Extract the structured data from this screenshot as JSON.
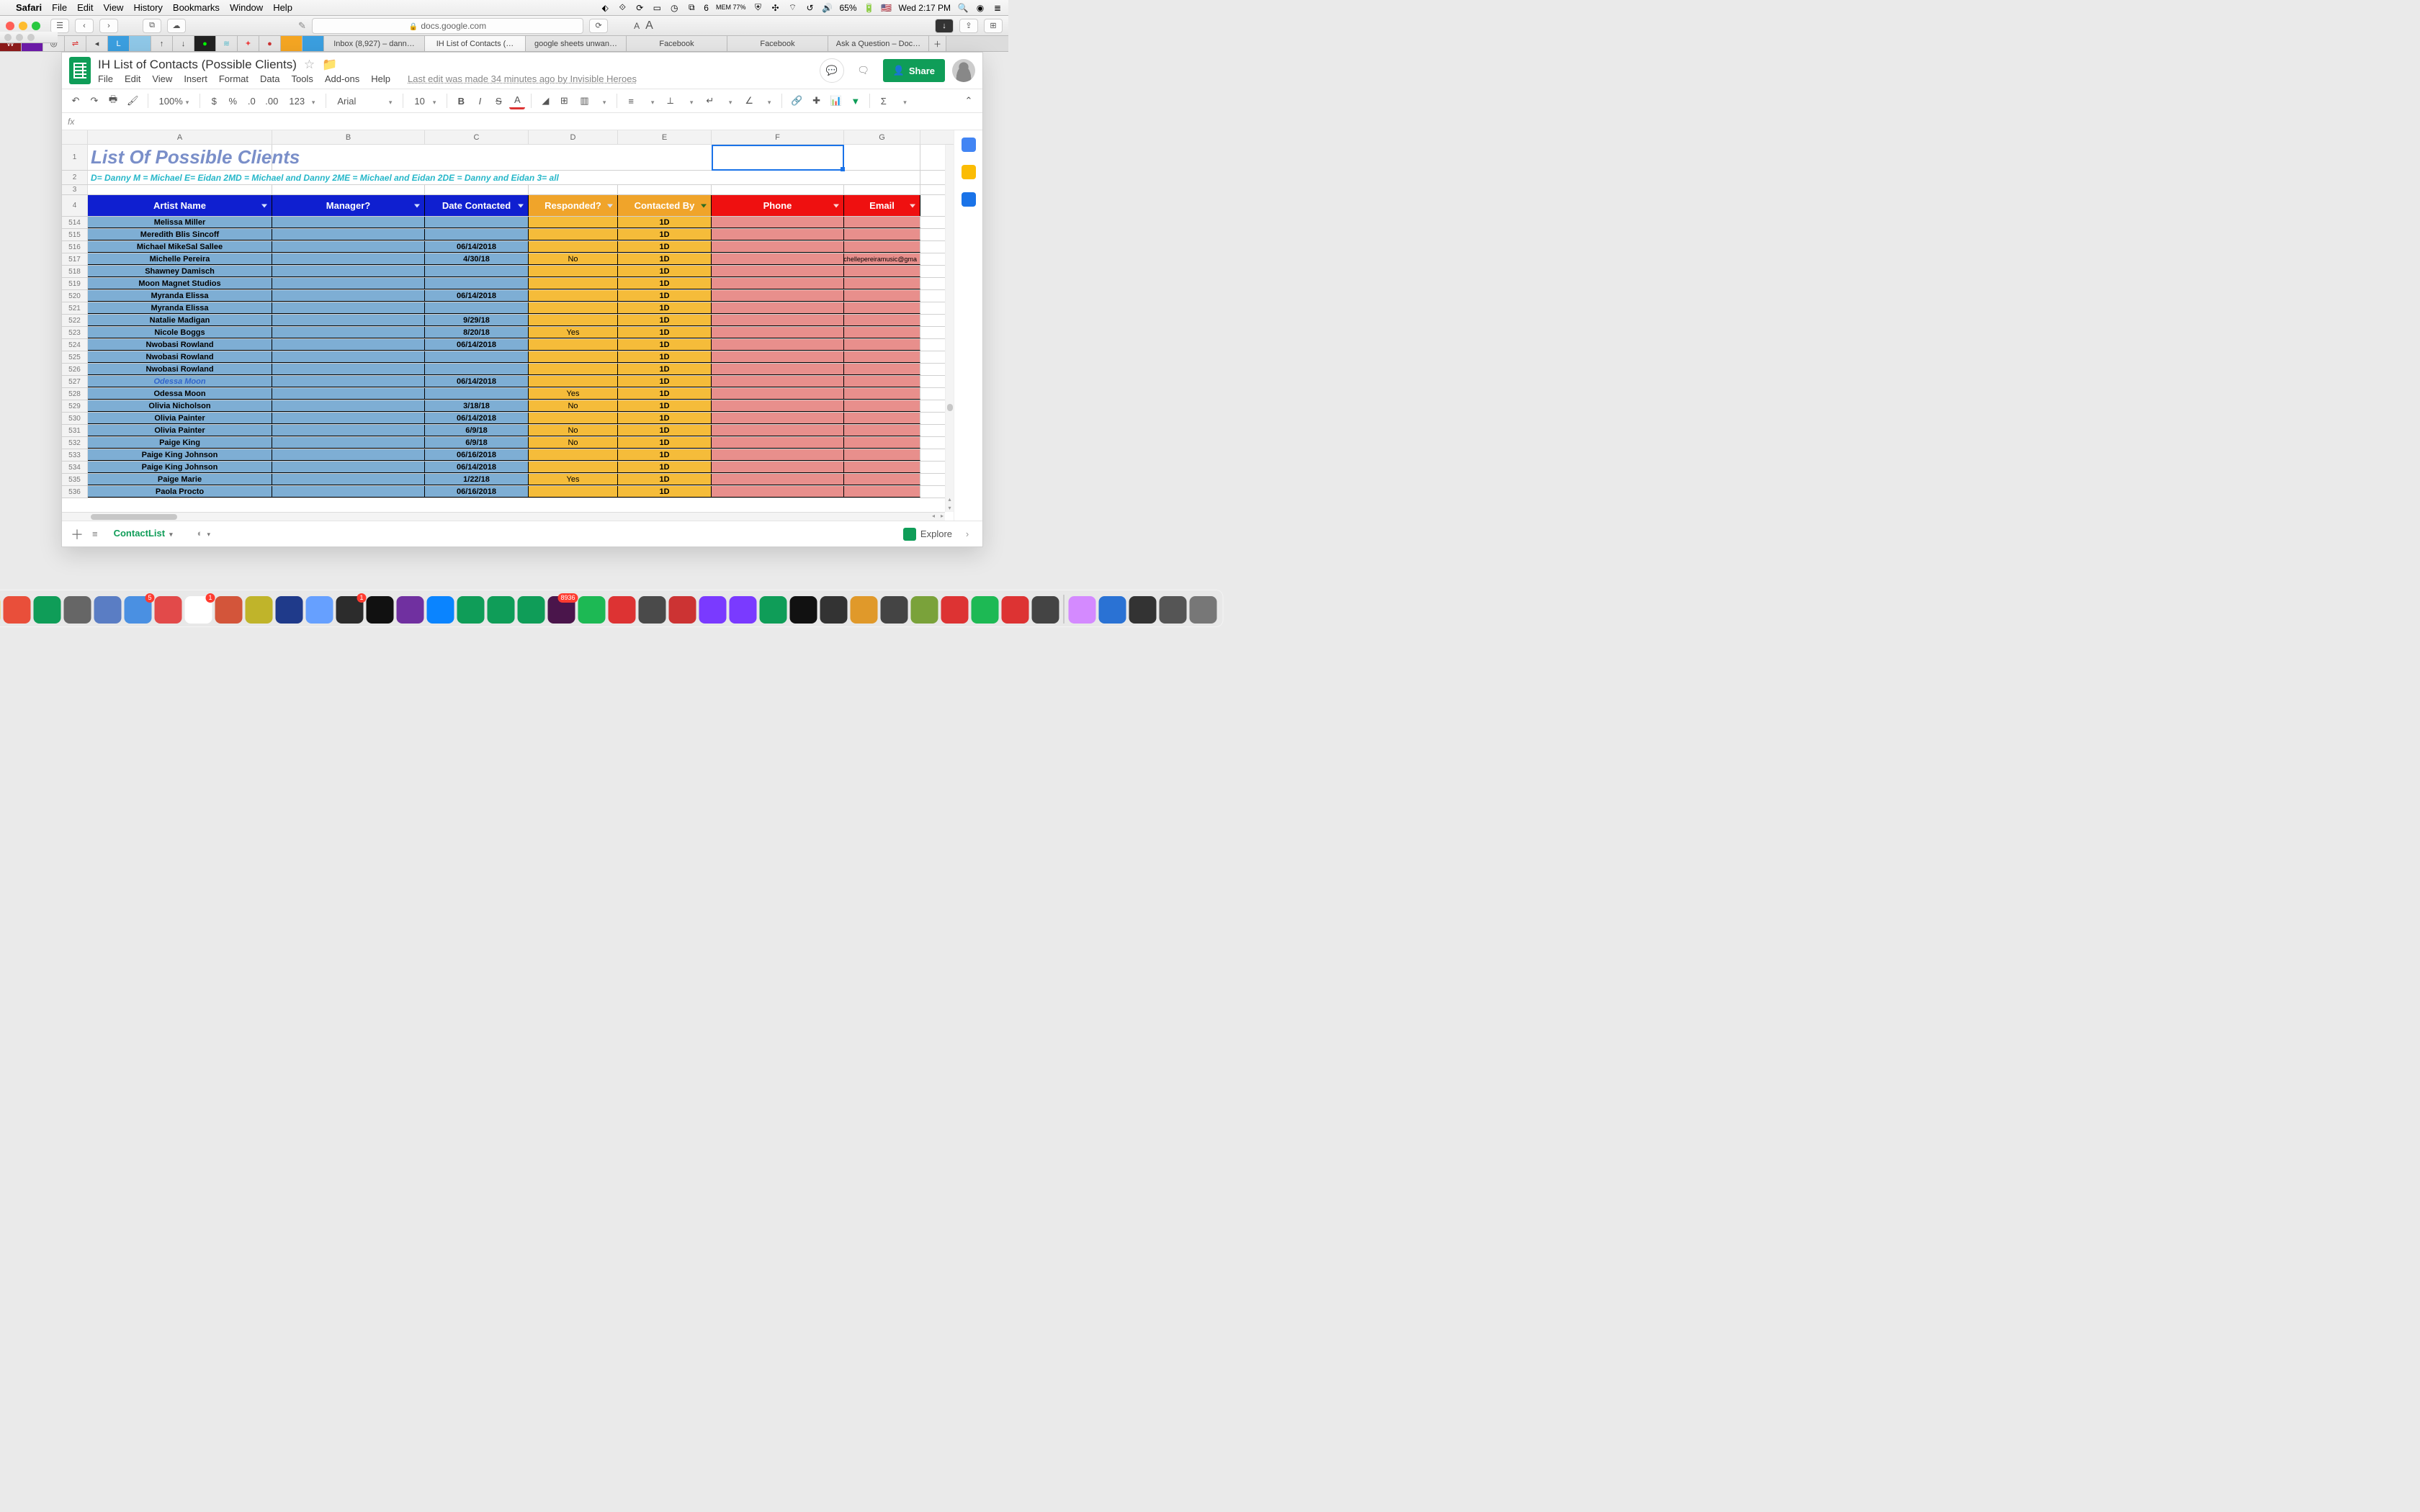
{
  "mac_menu": {
    "app": "Safari",
    "items": [
      "File",
      "Edit",
      "View",
      "History",
      "Bookmarks",
      "Window",
      "Help"
    ],
    "right_text": {
      "mem": "MEM 77%",
      "vpn_count": "6",
      "battery": "65%",
      "clock": "Wed 2:17 PM"
    }
  },
  "safari": {
    "url_host": "docs.google.com",
    "tabs": [
      {
        "label": "Inbox (8,927) – dann…"
      },
      {
        "label": "IH List of Contacts (…"
      },
      {
        "label": "google sheets unwan…"
      },
      {
        "label": "Facebook"
      },
      {
        "label": "Facebook"
      },
      {
        "label": "Ask a Question – Doc…"
      }
    ]
  },
  "sheets": {
    "doc_title": "IH List of Contacts (Possible Clients)",
    "menus": [
      "File",
      "Edit",
      "View",
      "Insert",
      "Format",
      "Data",
      "Tools",
      "Add-ons",
      "Help"
    ],
    "last_edit": "Last edit was made 34 minutes ago by Invisible Heroes",
    "share_label": "Share",
    "toolbar": {
      "zoom": "100%",
      "currency": "$",
      "percent": "%",
      "dec_less": ".0",
      "dec_more": ".00",
      "more_fmt": "123",
      "font": "Arial",
      "font_size": "10",
      "strike": "S"
    },
    "tab_name": "ContactList",
    "explore": "Explore"
  },
  "columns": [
    "A",
    "B",
    "C",
    "D",
    "E",
    "F",
    "G"
  ],
  "title_row": {
    "num": "1",
    "text": "List Of Possible Clients"
  },
  "legend_row": {
    "num": "2",
    "text": "D= Danny  M = Michael E= Eidan 2MD = Michael and Danny  2ME = Michael and Eidan 2DE = Danny and Eidan  3= all"
  },
  "blank_row": {
    "num": "3"
  },
  "header_row": {
    "num": "4",
    "cells": [
      {
        "label": "Artist Name",
        "bg": "#0f1fd0",
        "filter": "light"
      },
      {
        "label": "Manager?",
        "bg": "#0f1fd0",
        "filter": "light"
      },
      {
        "label": "Date Contacted",
        "bg": "#0f1fd0",
        "filter": "light"
      },
      {
        "label": "Responded?",
        "bg": "#f0a42a",
        "filter": "light"
      },
      {
        "label": "Contacted By",
        "bg": "#f0a42a",
        "filter": "dark"
      },
      {
        "label": "Phone",
        "bg": "#ef1010",
        "filter": "red"
      },
      {
        "label": "Email",
        "bg": "#ef1010",
        "filter": "red"
      }
    ]
  },
  "data_rows": [
    {
      "n": "514",
      "a": "Melissa Miller",
      "b": "",
      "c": "",
      "d": "",
      "e": "1D",
      "f": "",
      "g": ""
    },
    {
      "n": "515",
      "a": "Meredith Blis Sincoff",
      "b": "",
      "c": "",
      "d": "",
      "e": "1D",
      "f": "",
      "g": ""
    },
    {
      "n": "516",
      "a": "Michael MikeSal Sallee",
      "b": "",
      "c": "06/14/2018",
      "d": "",
      "e": "1D",
      "f": "",
      "g": ""
    },
    {
      "n": "517",
      "a": "Michelle Pereira",
      "b": "",
      "c": "4/30/18",
      "d": "No",
      "e": "1D",
      "f": "",
      "g": "michellepereiramusic@gma"
    },
    {
      "n": "518",
      "a": "Shawney Damisch",
      "b": "",
      "c": "",
      "d": "",
      "e": "1D",
      "f": "",
      "g": ""
    },
    {
      "n": "519",
      "a": "Moon Magnet Studios",
      "b": "",
      "c": "",
      "d": "",
      "e": "1D",
      "f": "",
      "g": ""
    },
    {
      "n": "520",
      "a": "Myranda Elissa",
      "b": "",
      "c": "06/14/2018",
      "d": "",
      "e": "1D",
      "f": "",
      "g": ""
    },
    {
      "n": "521",
      "a": "Myranda Elissa",
      "b": "",
      "c": "",
      "d": "",
      "e": "1D",
      "f": "",
      "g": ""
    },
    {
      "n": "522",
      "a": "Natalie Madigan",
      "b": "",
      "c": "9/29/18",
      "d": "",
      "e": "1D",
      "f": "",
      "g": ""
    },
    {
      "n": "523",
      "a": "Nicole Boggs",
      "b": "",
      "c": "8/20/18",
      "d": "Yes",
      "e": "1D",
      "f": "",
      "g": ""
    },
    {
      "n": "524",
      "a": "Nwobasi Rowland",
      "b": "",
      "c": "06/14/2018",
      "d": "",
      "e": "1D",
      "f": "",
      "g": ""
    },
    {
      "n": "525",
      "a": "Nwobasi Rowland",
      "b": "",
      "c": "",
      "d": "",
      "e": "1D",
      "f": "",
      "g": ""
    },
    {
      "n": "526",
      "a": "Nwobasi Rowland",
      "b": "",
      "c": "",
      "d": "",
      "e": "1D",
      "f": "",
      "g": ""
    },
    {
      "n": "527",
      "a": "Odessa Moon",
      "b": "",
      "c": "06/14/2018",
      "d": "",
      "e": "1D",
      "f": "",
      "g": "",
      "italic": true
    },
    {
      "n": "528",
      "a": "Odessa Moon",
      "b": "",
      "c": "",
      "d": "Yes",
      "e": "1D",
      "f": "",
      "g": ""
    },
    {
      "n": "529",
      "a": "Olivia Nicholson",
      "b": "",
      "c": "3/18/18",
      "d": "No",
      "e": "1D",
      "f": "",
      "g": ""
    },
    {
      "n": "530",
      "a": "Olivia Painter",
      "b": "",
      "c": "06/14/2018",
      "d": "",
      "e": "1D",
      "f": "",
      "g": ""
    },
    {
      "n": "531",
      "a": "Olivia Painter",
      "b": "",
      "c": "6/9/18",
      "d": "No",
      "e": "1D",
      "f": "",
      "g": ""
    },
    {
      "n": "532",
      "a": "Paige King",
      "b": "",
      "c": "6/9/18",
      "d": "No",
      "e": "1D",
      "f": "",
      "g": ""
    },
    {
      "n": "533",
      "a": "Paige King Johnson",
      "b": "",
      "c": "06/16/2018",
      "d": "",
      "e": "1D",
      "f": "",
      "g": ""
    },
    {
      "n": "534",
      "a": "Paige King Johnson",
      "b": "",
      "c": "06/14/2018",
      "d": "",
      "e": "1D",
      "f": "",
      "g": ""
    },
    {
      "n": "535",
      "a": "Paige Marie",
      "b": "",
      "c": "1/22/18",
      "d": "Yes",
      "e": "1D",
      "f": "",
      "g": ""
    },
    {
      "n": "536",
      "a": "Paola Procto",
      "b": "",
      "c": "06/16/2018",
      "d": "",
      "e": "1D",
      "f": "",
      "g": ""
    }
  ],
  "col_bg": {
    "a": "#7eaed4",
    "b": "#7eaed4",
    "c": "#7eaed4",
    "d": "#f5bc3a",
    "e": "#f5bc3a",
    "f": "#e88f8c",
    "g": "#e88f8c"
  },
  "selected_cell": {
    "col": "F",
    "row_num": "1"
  },
  "dock": {
    "badges": {
      "mail": "5",
      "messages": "1",
      "app1": "1",
      "slack": "8936"
    }
  }
}
